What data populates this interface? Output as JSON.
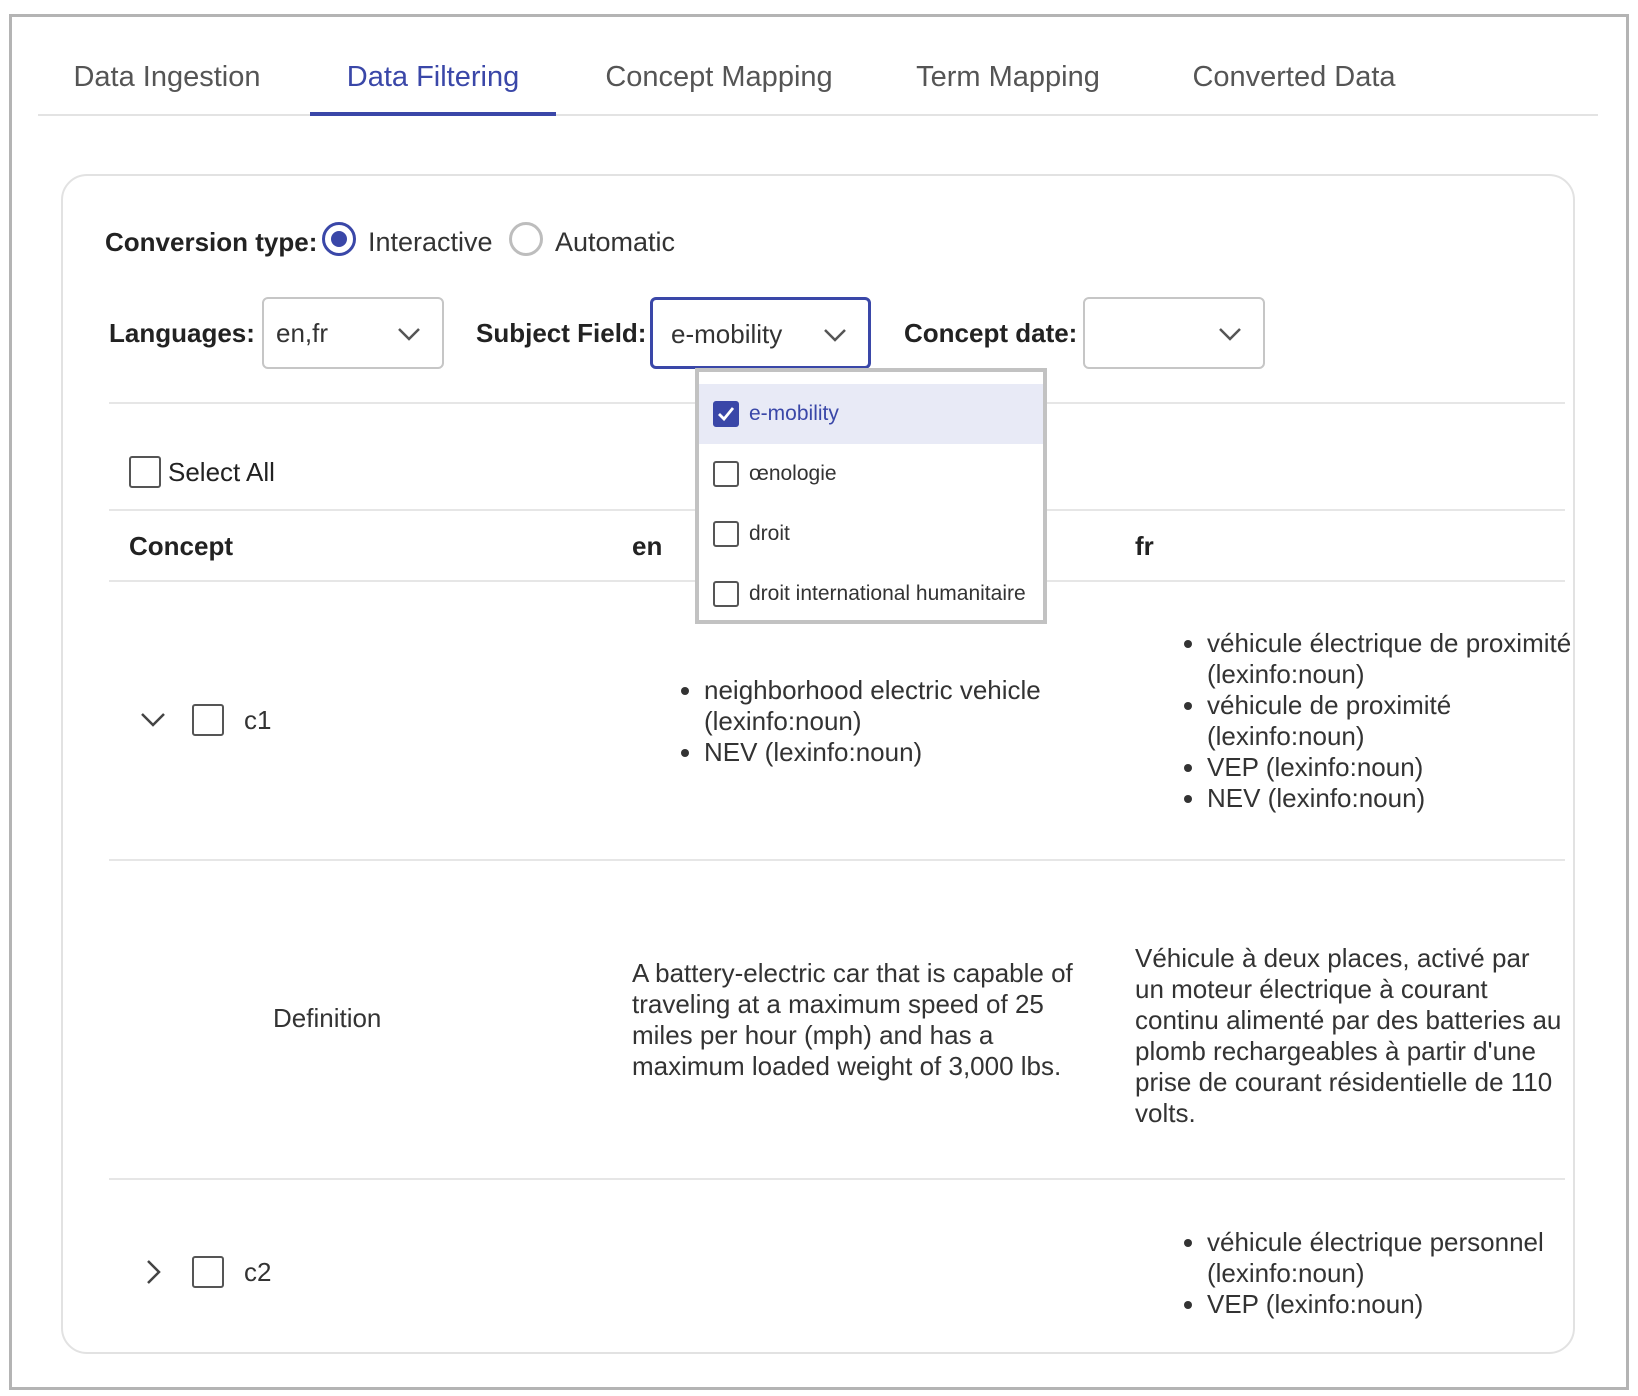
{
  "tabs": [
    {
      "label": "Data Ingestion",
      "active": false
    },
    {
      "label": "Data Filtering",
      "active": true
    },
    {
      "label": "Concept Mapping",
      "active": false
    },
    {
      "label": "Term Mapping",
      "active": false
    },
    {
      "label": "Converted Data",
      "active": false
    }
  ],
  "conversion": {
    "label": "Conversion type:",
    "options": [
      "Interactive",
      "Automatic"
    ],
    "selected": "Interactive"
  },
  "filters": {
    "languages_label": "Languages:",
    "languages_value": "en,fr",
    "subject_label": "Subject Field:",
    "subject_value": "e-mobility",
    "date_label": "Concept date:",
    "date_value": ""
  },
  "dropdown": {
    "options": [
      {
        "label": "e-mobility",
        "checked": true
      },
      {
        "label": "œnologie",
        "checked": false
      },
      {
        "label": "droit",
        "checked": false
      },
      {
        "label": "droit international humanitaire",
        "checked": false
      }
    ]
  },
  "table": {
    "select_all": "Select All",
    "headers": {
      "concept": "Concept",
      "en": "en",
      "fr": "fr"
    },
    "rows": [
      {
        "id": "c1",
        "expanded": true,
        "en_terms": [
          "neighborhood electric vehicle (lexinfo:noun)",
          "NEV (lexinfo:noun)"
        ],
        "fr_terms": [
          "véhicule électrique de proximité (lexinfo:noun)",
          "véhicule de proximité (lexinfo:noun)",
          "VEP (lexinfo:noun)",
          "NEV (lexinfo:noun)"
        ]
      },
      {
        "id": "c2",
        "expanded": false,
        "en_terms": [],
        "fr_terms": [
          "véhicule électrique personnel (lexinfo:noun)",
          "VEP (lexinfo:noun)"
        ]
      }
    ],
    "definition": {
      "label": "Definition",
      "en": "A battery-electric car that is capable of traveling at a maximum speed of 25 miles per hour (mph) and has a maximum loaded weight of 3,000 lbs.",
      "fr": "Véhicule à deux places, activé par un moteur électrique à courant continu alimenté par des batteries au plomb rechargeables à partir d'une prise de courant résidentielle de 110 volts."
    }
  },
  "colors": {
    "accent": "#3a47a8",
    "border": "#c6c6c6",
    "selected_bg": "#e8eaf6"
  }
}
